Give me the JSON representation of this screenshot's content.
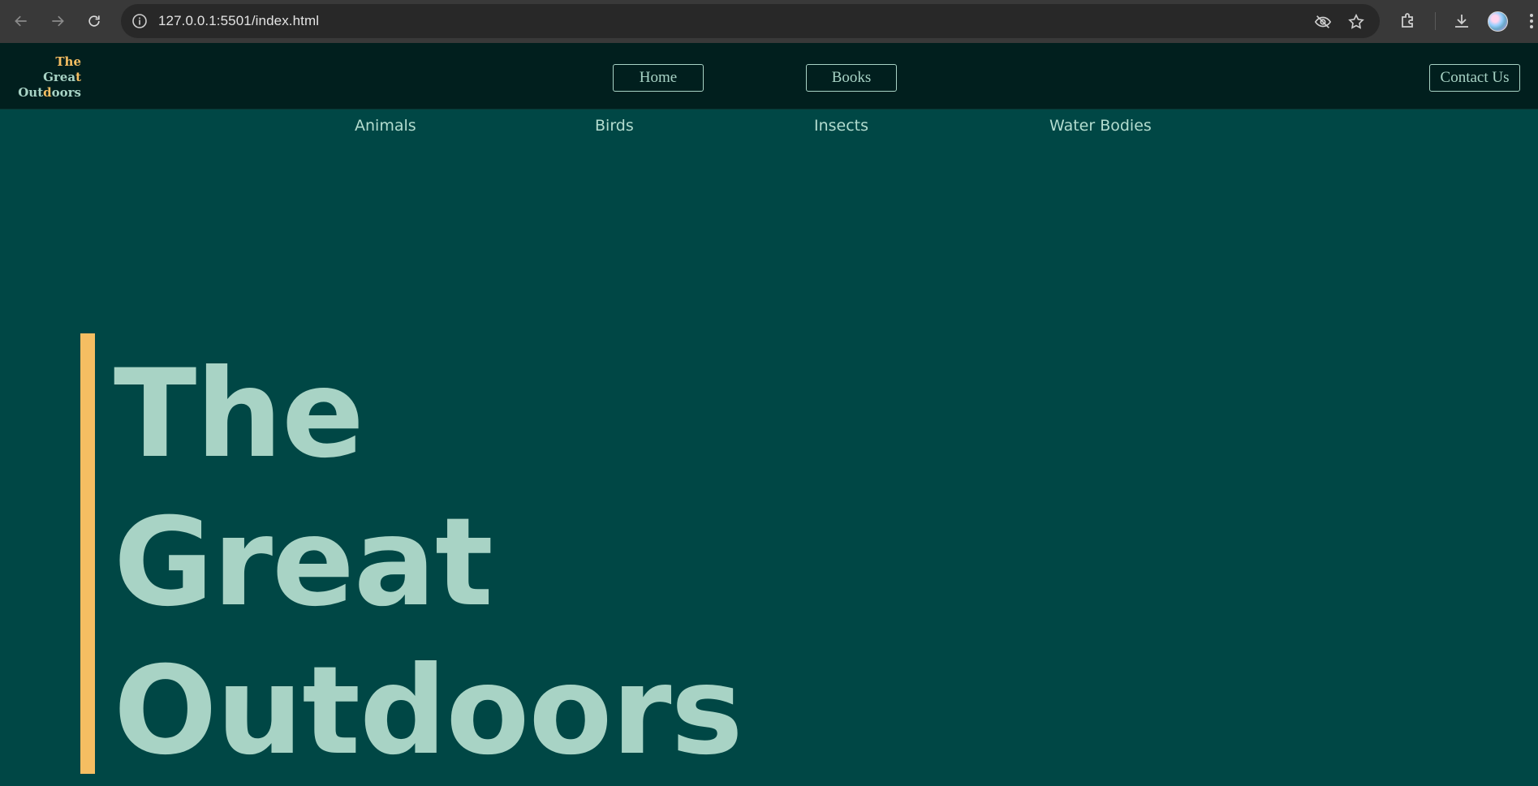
{
  "browser": {
    "url": "127.0.0.1:5501/index.html",
    "icons": {
      "back": "arrow-left-icon",
      "forward": "arrow-right-icon",
      "reload": "reload-icon",
      "site_info": "info-icon",
      "eye_off": "eye-off-icon",
      "bookmark": "star-icon",
      "extensions": "puzzle-icon",
      "downloads": "download-icon",
      "profile": "avatar",
      "menu": "more-vertical-icon"
    }
  },
  "header": {
    "logo_line1": "The",
    "logo_line2_a": "Grea",
    "logo_line2_b": "t",
    "logo_line3_a": "Out",
    "logo_line3_b": "d",
    "logo_line3_c": "oors",
    "home_label": "Home",
    "books_label": "Books",
    "contact_label": "Contact Us"
  },
  "sub_nav": {
    "items": [
      "Animals",
      "Birds",
      "Insects",
      "Water Bodies"
    ]
  },
  "hero": {
    "line1": "The",
    "line2": "Great",
    "line3": "Outdoors"
  },
  "colors": {
    "page_bg": "#004745",
    "header_bg": "#011f1e",
    "text_mint": "#a8d3c5",
    "accent": "#f5be62"
  }
}
